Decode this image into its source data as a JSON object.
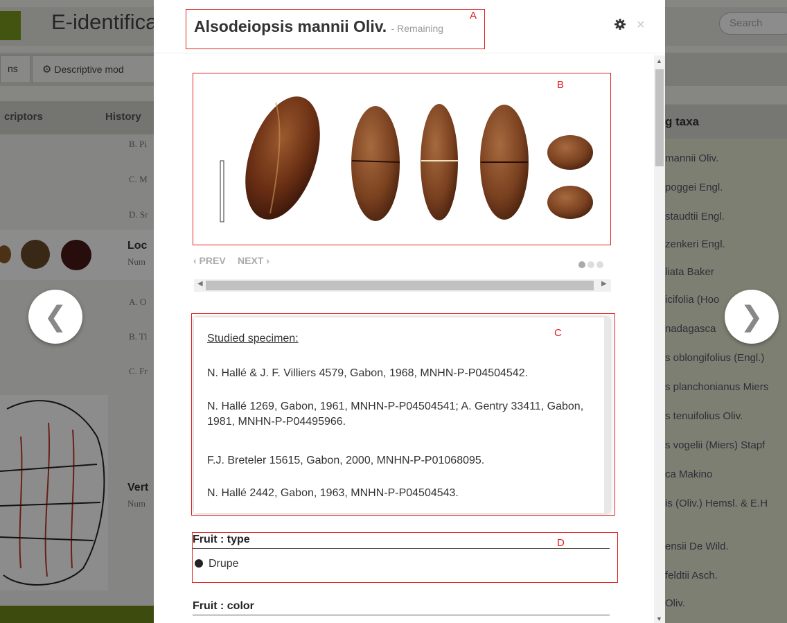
{
  "background": {
    "app_title": "E-identifica",
    "search_placeholder": "Search",
    "toolbar_btn_1": "ns",
    "toolbar_btn_2": "Descriptive mod",
    "tab_descriptors": "criptors",
    "tab_history": "History",
    "rows": [
      "B. Pi",
      "C. M",
      "D. Sr",
      "A. O",
      "B. Tl",
      "C. Fr"
    ],
    "card_title": "Loc",
    "card_sub": "Num",
    "vert_title": "Vert",
    "vert_sub": "Num",
    "taxa_title": "g taxa",
    "taxa": [
      "mannii Oliv.",
      "poggei Engl.",
      "staudtii Engl.",
      "zenkeri Engl.",
      "liata Baker",
      "icifolia (Hoo",
      "nadagasca",
      "s oblongifolius (Engl.)",
      "s planchonianus Miers",
      "s tenuifolius Oliv.",
      "s vogelii (Miers) Stapf",
      "ca Makino",
      "is (Oliv.) Hemsl. & E.H",
      "ensii De Wild.",
      "feldtii Asch.",
      "Oliv."
    ]
  },
  "modal": {
    "title": "Alsodeiopsis mannii Oliv.",
    "subtitle": "- Remaining",
    "close_label": "×",
    "pager": {
      "prev": "‹ PREV",
      "next": "NEXT ›",
      "pages": 3,
      "active_page": 1
    },
    "specimens": {
      "heading": "Studied specimen:",
      "lines": [
        "N. Hallé & J. F. Villiers 4579, Gabon, 1968, MNHN-P-P04504542.",
        "N. Hallé 1269, Gabon, 1961, MNHN-P-P04504541; A. Gentry 33411, Gabon, 1981, MNHN-P-P04495966.",
        "F.J. Breteler 15615, Gabon, 2000, MNHN-P-P01068095.",
        "N. Hallé 2442, Gabon, 1963, MNHN-P-P04504543."
      ]
    },
    "descriptors": [
      {
        "title": "Fruit : type",
        "value": "Drupe"
      },
      {
        "title": "Fruit : color",
        "value": ""
      }
    ]
  },
  "annotations": {
    "a": "A",
    "b": "B",
    "c": "C",
    "d": "D"
  },
  "colors": {
    "annotation": "#e02020",
    "brand_green": "#7a9a1e",
    "overlay": "rgba(0,0,0,0.45)"
  }
}
